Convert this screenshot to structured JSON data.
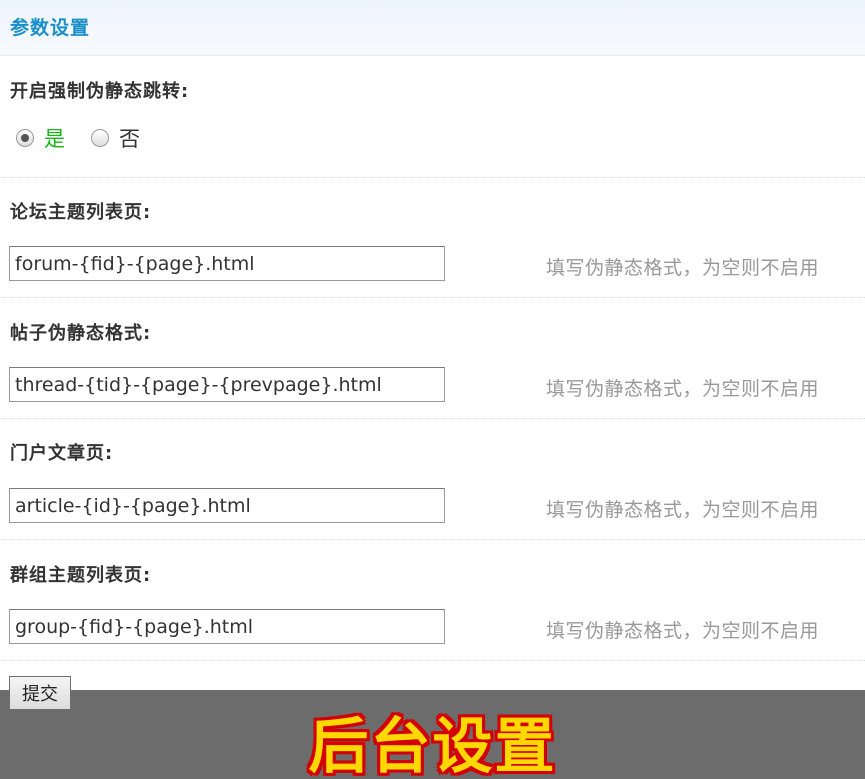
{
  "header": {
    "title": "参数设置"
  },
  "settings": {
    "force_rewrite": {
      "label": "开启强制伪静态跳转:",
      "options": [
        {
          "label": "是",
          "checked": true
        },
        {
          "label": "否",
          "checked": false
        }
      ]
    },
    "fields": [
      {
        "label": "论坛主题列表页:",
        "value": "forum-{fid}-{page}.html",
        "hint": "填写伪静态格式，为空则不启用"
      },
      {
        "label": "帖子伪静态格式:",
        "value": "thread-{tid}-{page}-{prevpage}.html",
        "hint": "填写伪静态格式，为空则不启用"
      },
      {
        "label": "门户文章页:",
        "value": "article-{id}-{page}.html",
        "hint": "填写伪静态格式，为空则不启用"
      },
      {
        "label": "群组主题列表页:",
        "value": "group-{fid}-{page}.html",
        "hint": "填写伪静态格式，为空则不启用"
      }
    ]
  },
  "submit": {
    "label": "提交"
  },
  "banner": {
    "text": "后台设置"
  },
  "colors": {
    "title_blue": "#1a8fc8",
    "yes_green": "#1cb51c",
    "hint_gray": "#999999",
    "banner_yellow": "#ffd800",
    "banner_outline_red": "#d40000"
  }
}
